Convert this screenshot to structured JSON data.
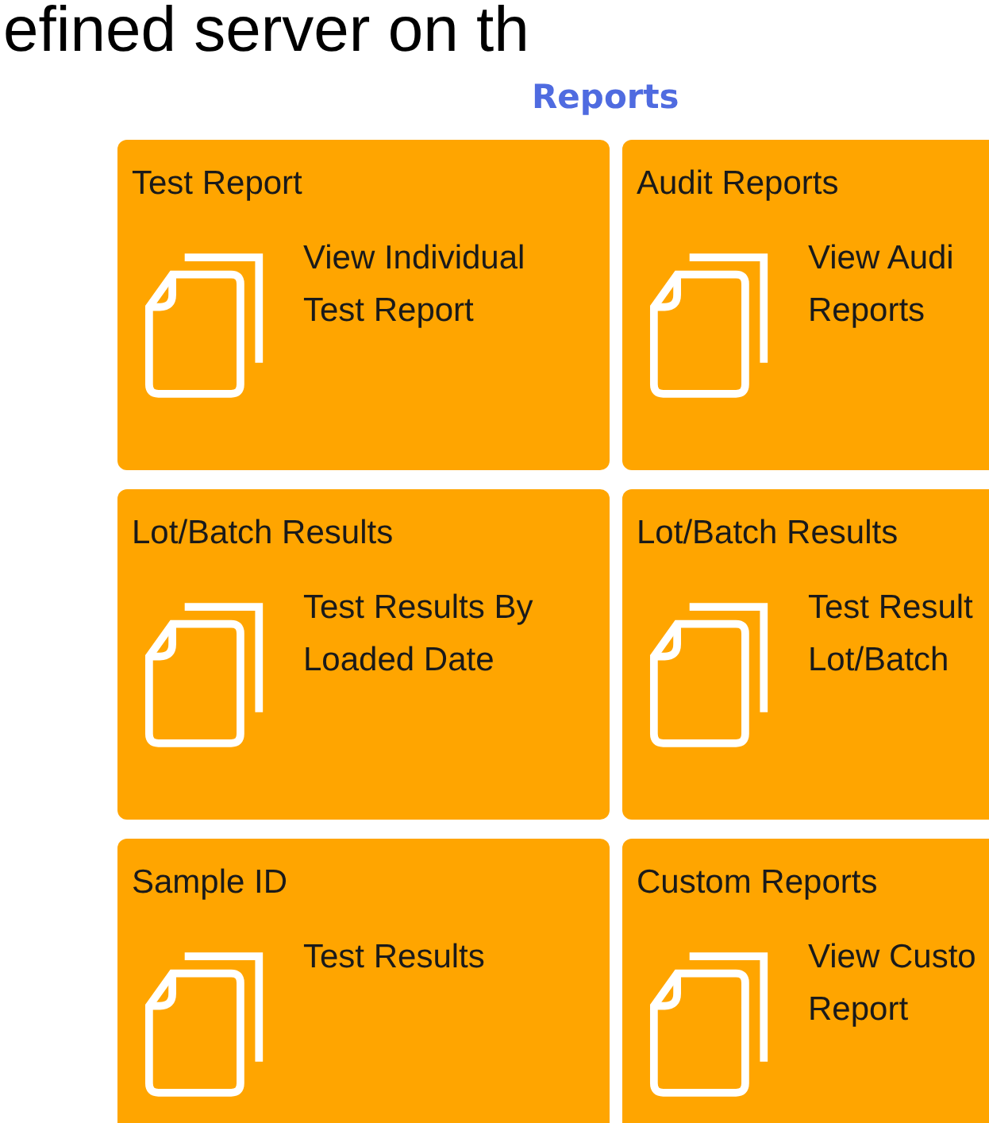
{
  "heading": "efined server on th",
  "section_title": "Reports",
  "tiles": [
    {
      "title": "Test Report",
      "link": "View Individual Test Report"
    },
    {
      "title": "Audit Reports",
      "link": "View Audi Reports"
    },
    {
      "title": "Lot/Batch Results",
      "link": "Test Results By Loaded Date"
    },
    {
      "title": "Lot/Batch Results",
      "link": "Test Result Lot/Batch"
    },
    {
      "title": "Sample ID",
      "link": "Test Results"
    },
    {
      "title": "Custom Reports",
      "link": "View Custo Report"
    }
  ]
}
